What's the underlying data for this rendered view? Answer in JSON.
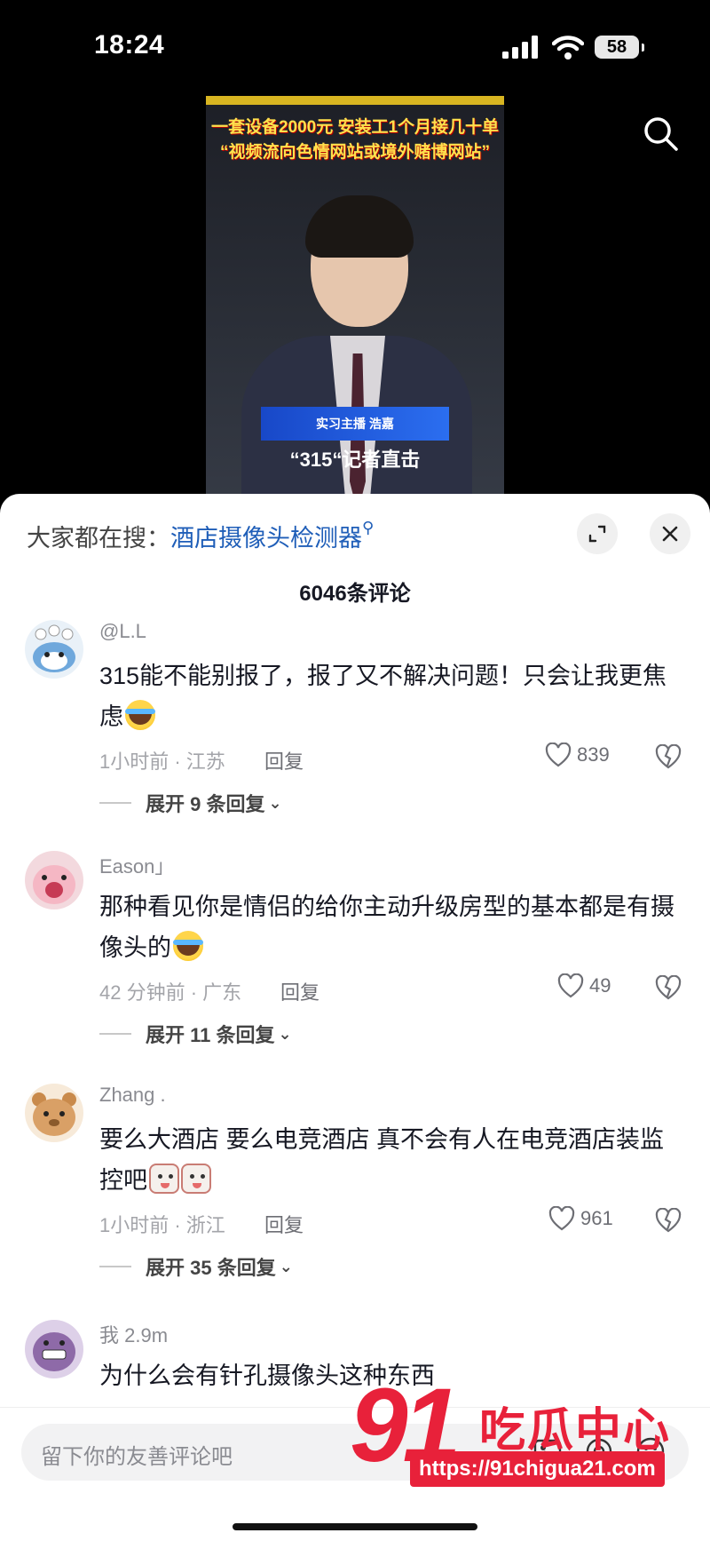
{
  "status_bar": {
    "time": "18:24",
    "battery": "58"
  },
  "video": {
    "headline_lines": [
      "一套设备2000元 安装工1个月接几十单",
      "“视频流向色情网站或境外赌博网站”"
    ],
    "caption_bar": "实习主播 浩嘉",
    "caption_sub": "“315“记者直击"
  },
  "sheet": {
    "trend_prefix": "大家都在搜：",
    "trend_term": "酒店摄像头检测器",
    "comment_count": "6046条评论"
  },
  "comments": [
    {
      "user": "@L.L",
      "text": "315能不能别报了，报了又不解决问题！只会让我更焦虑",
      "emoji": "cry-laugh",
      "meta": "1小时前 · 江苏",
      "reply": "回复",
      "likes": "839",
      "more": "展开 9 条回复"
    },
    {
      "user": "Eason」",
      "text": "那种看见你是情侣的给你主动升级房型的基本都是有摄像头的",
      "emoji": "cry-laugh",
      "meta": "42 分钟前 · 广东",
      "reply": "回复",
      "likes": "49",
      "more": "展开 11 条回复"
    },
    {
      "user": "Zhang .",
      "text": "要么大酒店 要么电竞酒店 真不会有人在电竞酒店装监控吧",
      "emoji": "dog-face",
      "meta": "1小时前 · 浙江",
      "reply": "回复",
      "likes": "961",
      "more": "展开 35 条回复"
    },
    {
      "user": "我 2.9m",
      "text": "为什么会有针孔摄像头这种东西"
    }
  ],
  "input": {
    "placeholder": "留下你的友善评论吧"
  },
  "watermark": {
    "number": "91",
    "name": "吃瓜中心",
    "url": "https://91chigua21.com"
  },
  "colors": {
    "accent": "#e8213a",
    "link": "#1f5eb8",
    "caption_blue": "#2b6ef0"
  }
}
